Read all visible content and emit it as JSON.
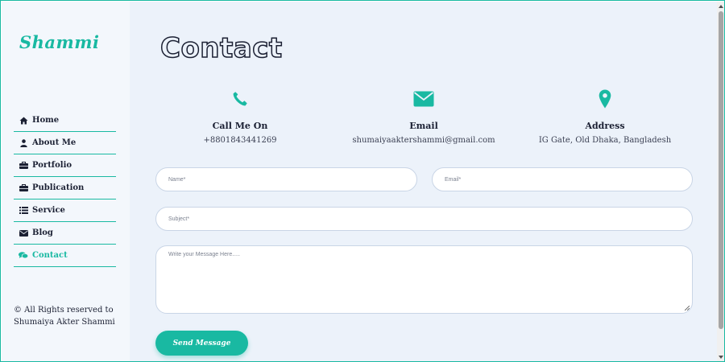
{
  "brand": {
    "name": "Shammi"
  },
  "sidebar": {
    "items": [
      {
        "label": "Home",
        "icon": "home-icon"
      },
      {
        "label": "About Me",
        "icon": "user-icon"
      },
      {
        "label": "Portfolio",
        "icon": "briefcase-icon"
      },
      {
        "label": "Publication",
        "icon": "briefcase-icon"
      },
      {
        "label": "Service",
        "icon": "list-icon"
      },
      {
        "label": "Blog",
        "icon": "envelope-icon"
      },
      {
        "label": "Contact",
        "icon": "comments-icon",
        "active": true
      }
    ],
    "copyright": "© All Rights reserved to Shumaiya Akter Shammi"
  },
  "page": {
    "title": "Contact"
  },
  "contact_info": [
    {
      "icon": "phone-icon",
      "heading": "Call Me On",
      "value": "+8801843441269"
    },
    {
      "icon": "envelope-icon",
      "heading": "Email",
      "value": "shumaiyaaktershammi@gmail.com"
    },
    {
      "icon": "map-marker-icon",
      "heading": "Address",
      "value": "IG Gate, Old Dhaka, Bangladesh"
    }
  ],
  "form": {
    "name_placeholder": "Name*",
    "email_placeholder": "Email*",
    "subject_placeholder": "Subject*",
    "message_placeholder": "Write your Message Here.....",
    "submit_label": "Send Message"
  },
  "colors": {
    "accent": "#19b9a2",
    "text": "#1b2033",
    "sidebar_bg": "#f3f7fc",
    "main_bg": "#ecf2fa"
  }
}
